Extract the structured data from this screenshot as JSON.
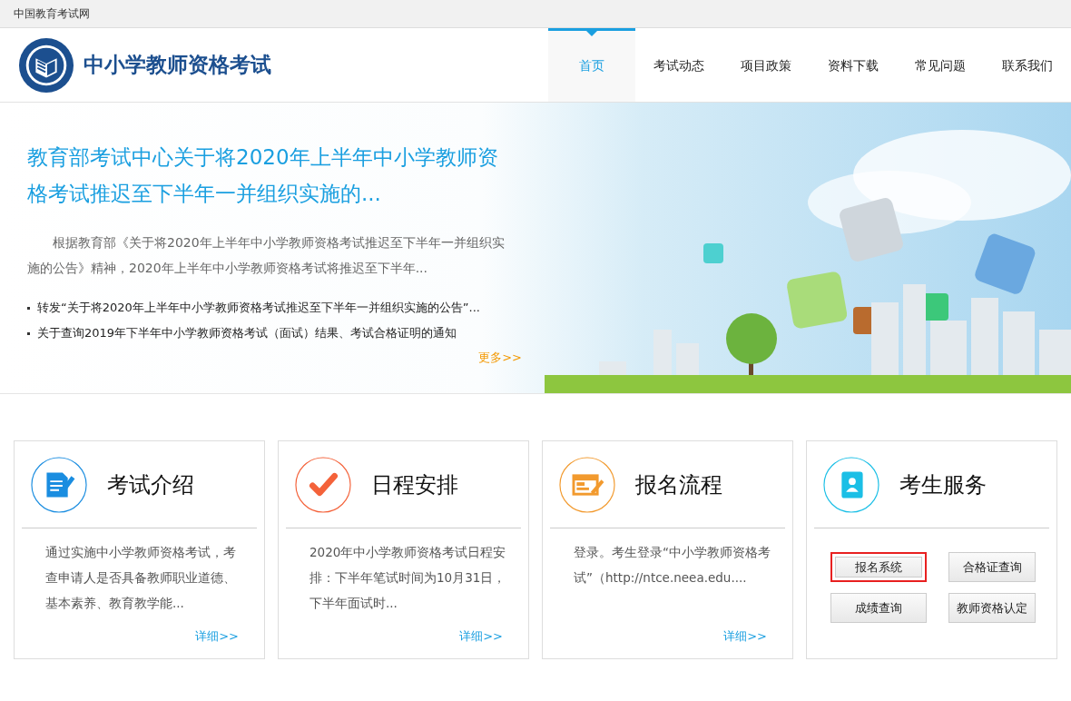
{
  "top_bar": {
    "label": "中国教育考试网"
  },
  "header": {
    "site_title": "中小学教师资格考试"
  },
  "nav": [
    {
      "label": "首页",
      "selected": true
    },
    {
      "label": "考试动态",
      "selected": false
    },
    {
      "label": "项目政策",
      "selected": false
    },
    {
      "label": "资料下载",
      "selected": false
    },
    {
      "label": "常见问题",
      "selected": false
    },
    {
      "label": "联系我们",
      "selected": false
    }
  ],
  "hero": {
    "headline": "教育部考试中心关于将2020年上半年中小学教师资格考试推迟至下半年一并组织实施的...",
    "summary": "根据教育部《关于将2020年上半年中小学教师资格考试推迟至下半年一并组织实施的公告》精神，2020年上半年中小学教师资格考试将推迟至下半年...",
    "news": [
      "转发“关于将2020年上半年中小学教师资格考试推迟至下半年一并组织实施的公告”...",
      "关于查询2019年下半年中小学教师资格考试（面试）结果、考试合格证明的通知"
    ],
    "more_link": "更多>>"
  },
  "cards": [
    {
      "kind": "info",
      "title": "考试介绍",
      "color": "#1a8de0",
      "text": "通过实施中小学教师资格考试，考查申请人是否具备教师职业道德、基本素养、教育教学能...",
      "link": "详细>>"
    },
    {
      "kind": "info",
      "title": "日程安排",
      "color": "#f4623a",
      "text": "2020年中小学教师资格考试日程安排：下半年笔试时间为10月31日，下半年面试时...",
      "link": "详细>>"
    },
    {
      "kind": "info",
      "title": "报名流程",
      "color": "#f29a2e",
      "text": "登录。考生登录“中小学教师资格考试”（http://ntce.neea.edu....",
      "link": "详细>>"
    },
    {
      "kind": "services",
      "title": "考生服务",
      "color": "#1bbfe6",
      "buttons": [
        {
          "label": "报名系统",
          "highlighted": true
        },
        {
          "label": "合格证查询",
          "highlighted": false
        },
        {
          "label": "成绩查询",
          "highlighted": false
        },
        {
          "label": "教师资格认定",
          "highlighted": false
        }
      ]
    }
  ]
}
